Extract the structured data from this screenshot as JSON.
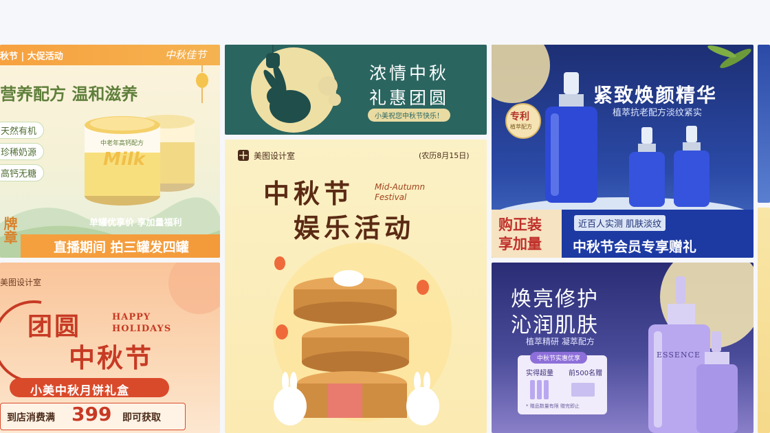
{
  "cards": {
    "milk": {
      "tag": "秋节 | 大促活动",
      "logo": "中秋佳节",
      "headline": "营养配方 温和滋养",
      "features": [
        "天然有机",
        "珍稀奶源",
        "高钙无糖"
      ],
      "product_word": "Milk",
      "can_label": "中老年高钙配方",
      "offer": "单罐优享价 享加量福利",
      "side_text": "牌章",
      "footer": "直播期间 拍三罐发四罐"
    },
    "greet": {
      "title_line1": "浓情中秋",
      "title_line2": "礼惠团圆",
      "subtitle": "小美祝您中秋节快乐！"
    },
    "essence": {
      "title": "紧致焕颜精华",
      "subtitle": "植萃抗老配方淡纹紧实",
      "patent_badge": "专利",
      "patent_sub": "植萃配方",
      "left_block": "购正装享加量",
      "tested": "近百人实测 肌肤淡纹",
      "footer": "中秋节会员专享赠礼"
    },
    "reunion": {
      "brand": "美图设计室",
      "title_a": "团圆",
      "title_b": "中秋节",
      "happy": "HAPPY",
      "holidays": "HOLIDAYS",
      "gift": "小美中秋月饼礼盒",
      "cond_pre": "到店消费满",
      "cond_num": "399",
      "cond_post": "即可获取"
    },
    "mooncake": {
      "brand": "美图设计室",
      "date": "(农历8月15日)",
      "title_a": "中秋节",
      "title_b": "娱乐活动",
      "en_a": "Mid-Autumn",
      "en_b": "Festival"
    },
    "repair": {
      "title_a": "焕亮修护",
      "title_b": "沁润肌肤",
      "subtitle": "植萃精研 凝萃配方",
      "box_title": "中秋节实惠优享",
      "box_left": "实得超量",
      "box_right": "前500名赠",
      "box_note": "* 赠品数量有限 赠完即止",
      "bottle_brand": "ESSENCE"
    }
  },
  "colors": {
    "page_bg": "#f6f7fa",
    "teal": "#2b6560",
    "navy": "#1f3a86",
    "orange": "#f08a3a",
    "purple": "#4a4c9a"
  }
}
